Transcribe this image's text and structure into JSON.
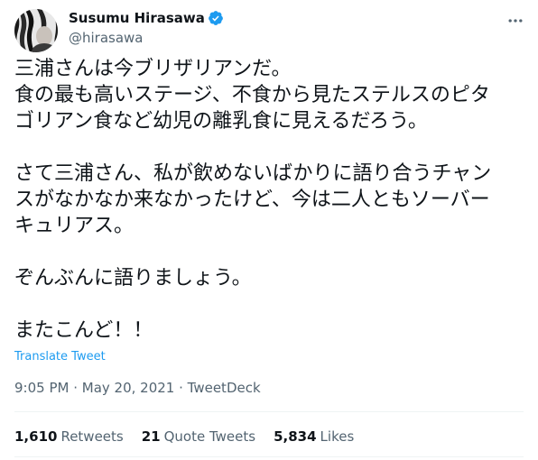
{
  "author": {
    "display_name": "Susumu Hirasawa",
    "handle": "@hirasawa",
    "verified": true
  },
  "tweet": {
    "paragraphs": [
      [
        "三浦さんは今ブリザリアンだ。",
        "食の最も高いステージ、不食から見たステルスのピタ",
        "ゴリアン食など幼児の離乳食に見えるだろう。"
      ],
      [
        "さて三浦さん、私が飲めないばかりに語り合うチャン",
        "スがなかなか来なかったけど、今は二人ともソーバー",
        "キュリアス。"
      ],
      [
        "ぞんぶんに語りましょう。"
      ],
      [
        "またこんど！！"
      ]
    ],
    "translate_label": "Translate Tweet",
    "time": "9:05 PM",
    "date": "May 20, 2021",
    "separator": " · ",
    "client": "TweetDeck"
  },
  "stats": {
    "retweets_count": "1,610",
    "retweets_label": "Retweets",
    "quote_tweets_count": "21",
    "quote_tweets_label": "Quote Tweets",
    "likes_count": "5,834",
    "likes_label": "Likes"
  },
  "icons": {
    "verified": "verified-badge-icon",
    "more": "more-options-icon"
  },
  "colors": {
    "accent": "#1d9bf0",
    "text": "#0f1419",
    "muted": "#536471"
  }
}
